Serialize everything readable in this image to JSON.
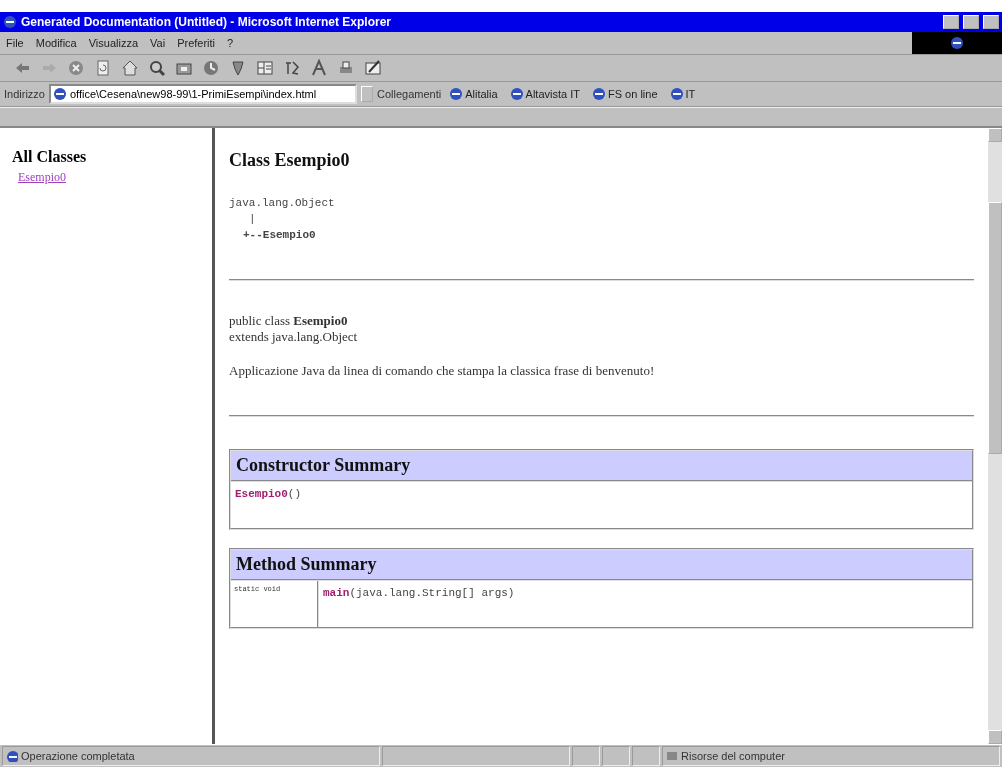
{
  "window": {
    "title": "Generated Documentation (Untitled) - Microsoft Internet Explorer"
  },
  "menu": [
    "File",
    "Modifica",
    "Visualizza",
    "Vai",
    "Preferiti",
    "?"
  ],
  "toolbar": [
    {
      "kind": "back"
    },
    {
      "kind": "forward"
    },
    {
      "kind": "stop"
    },
    {
      "kind": "refresh"
    },
    {
      "kind": "home"
    },
    {
      "kind": "search"
    },
    {
      "kind": "folder"
    },
    {
      "kind": "history"
    },
    {
      "kind": "mail"
    },
    {
      "kind": "frames"
    },
    {
      "kind": "translate"
    },
    {
      "kind": "font"
    },
    {
      "kind": "print"
    },
    {
      "kind": "edit"
    }
  ],
  "address": {
    "label": "Indirizzo",
    "value": "office\\Cesena\\new98-99\\1-PrimiEsempi\\index.html"
  },
  "links": {
    "label": "Collegamenti",
    "items": [
      "Alitalia",
      "Altavista IT",
      "FS on line",
      "IT"
    ]
  },
  "sidebar": {
    "heading": "All Classes",
    "items": [
      {
        "label": "Esempio0"
      }
    ]
  },
  "doc": {
    "title": "Class Esempio0",
    "hierarchy": [
      "java.lang.Object",
      "|",
      "+--Esempio0"
    ],
    "declaration": [
      "public class **Esempio0**",
      "extends java.lang.Object"
    ],
    "description": "Applicazione Java da linea di comando che stampa la classica frase di benvenuto!",
    "constructor_summary": {
      "title": "Constructor Summary",
      "rows": [
        {
          "name": "Esempio0",
          "signature": "()"
        }
      ]
    },
    "method_summary": {
      "title": "Method Summary",
      "rows": [
        {
          "modifier": "static void",
          "name": "main",
          "signature": "(java.lang.String[] args)"
        }
      ]
    }
  },
  "status_bar": {
    "message": "Operazione completata",
    "zone": "Risorse del computer"
  }
}
